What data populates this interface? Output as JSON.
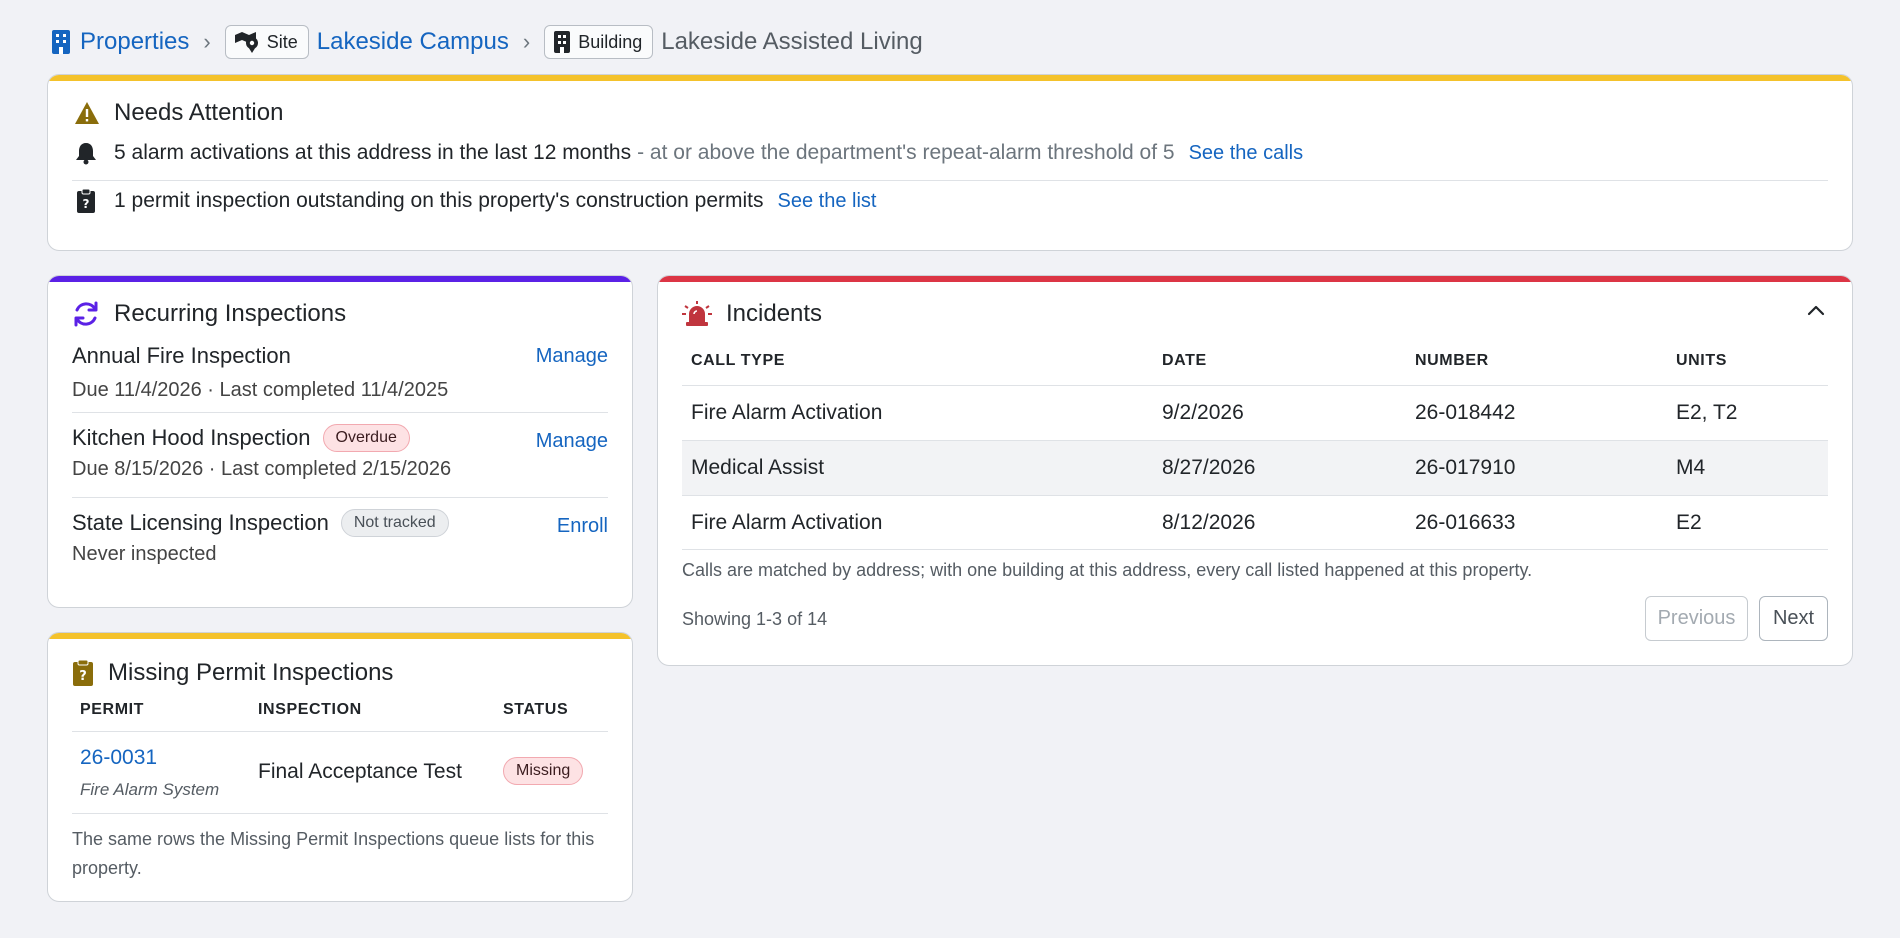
{
  "breadcrumb": {
    "root_label": "Properties",
    "site_chip": "Site",
    "site_label": "Lakeside Campus",
    "building_chip": "Building",
    "current_label": "Lakeside Assisted Living",
    "separator": "›"
  },
  "attention": {
    "title": "Needs Attention",
    "alarm": {
      "text": "5 alarm activations at this address in the last 12 months",
      "detail": "- at or above the department's repeat-alarm threshold of 5",
      "link": "See the calls"
    },
    "permit": {
      "text": "1 permit inspection outstanding on this property's construction permits",
      "link": "See the list"
    }
  },
  "recurring": {
    "title": "Recurring Inspections",
    "items": [
      {
        "name": "Annual Fire Inspection",
        "badge": "",
        "meta": "Due 11/4/2026 · Last completed 11/4/2025",
        "action": "Manage"
      },
      {
        "name": "Kitchen Hood Inspection",
        "badge": "Overdue",
        "meta": "Due 8/15/2026 · Last completed 2/15/2026",
        "action": "Manage"
      },
      {
        "name": "State Licensing Inspection",
        "badge": "Not tracked",
        "meta": "Never inspected",
        "action": "Enroll"
      }
    ]
  },
  "missing": {
    "title": "Missing Permit Inspections",
    "columns": [
      "PERMIT",
      "INSPECTION",
      "STATUS"
    ],
    "rows": [
      {
        "permit": "26-0031",
        "permit_type": "Fire Alarm System",
        "inspection": "Final Acceptance Test",
        "status": "Missing"
      }
    ],
    "note": "The same rows the Missing Permit Inspections queue lists for this property."
  },
  "incidents": {
    "title": "Incidents",
    "columns": [
      "CALL TYPE",
      "DATE",
      "NUMBER",
      "UNITS"
    ],
    "rows": [
      {
        "call_type": "Fire Alarm Activation",
        "date": "9/2/2026",
        "number": "26-018442",
        "units": "E2, T2"
      },
      {
        "call_type": "Medical Assist",
        "date": "8/27/2026",
        "number": "26-017910",
        "units": "M4"
      },
      {
        "call_type": "Fire Alarm Activation",
        "date": "8/12/2026",
        "number": "26-016633",
        "units": "E2"
      }
    ],
    "note": "Calls are matched by address; with one building at this address, every call listed happened at this property.",
    "showing": "Showing 1-3 of 14",
    "prev_label": "Previous",
    "next_label": "Next"
  },
  "colors": {
    "link": "#1565c0",
    "attention_bar": "#f4c22b",
    "recurring_bar": "#5b21e6",
    "incidents_bar": "#dc3545",
    "missing_bar": "#f4c22b"
  }
}
